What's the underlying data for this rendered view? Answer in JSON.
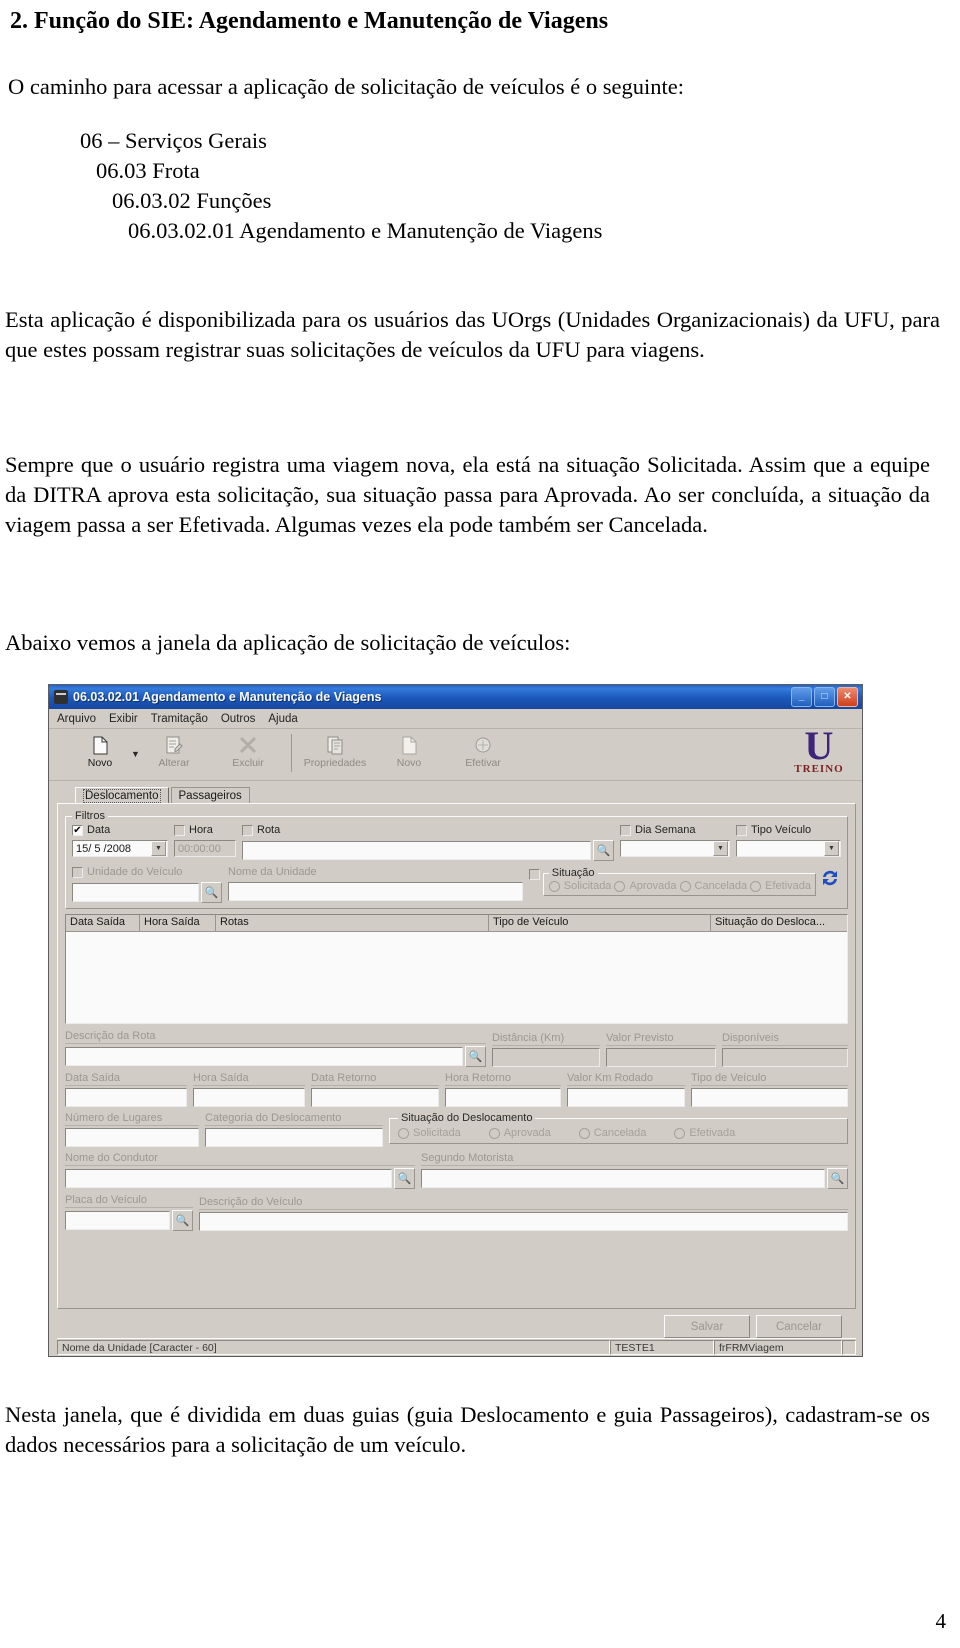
{
  "document": {
    "title": "2. Função do SIE: Agendamento e Manutenção de Viagens",
    "intro": "O caminho para acessar a aplicação de solicitação de veículos é o seguinte:",
    "path": [
      "06 – Serviços Gerais",
      "06.03 Frota",
      "06.03.02 Funções",
      "06.03.02.01 Agendamento e Manutenção de Viagens"
    ],
    "paragraph_1": "Esta aplicação é disponibilizada para os usuários das UOrgs (Unidades Organizacionais) da UFU, para que estes possam registrar suas solicitações de veículos da UFU para viagens.",
    "paragraph_2": "Sempre que o usuário registra uma viagem nova, ela está na situação Solicitada. Assim que a equipe da DITRA aprova esta solicitação, sua situação passa para Aprovada. Ao ser concluída, a situação da viagem passa a ser Efetivada. Algumas vezes ela pode também ser Cancelada.",
    "paragraph_3": "Abaixo vemos a janela da aplicação de solicitação de veículos:",
    "paragraph_4": "Nesta janela, que é dividida em duas guias (guia Deslocamento e guia Passageiros), cadastram-se os dados necessários para a solicitação de um veículo.",
    "page_number": "4"
  },
  "app": {
    "title": "06.03.02.01 Agendamento e Manutenção de Viagens",
    "window_buttons": {
      "minimize": "_",
      "maximize": "□",
      "close": "✕"
    },
    "menu": [
      "Arquivo",
      "Exibir",
      "Tramitação",
      "Outros",
      "Ajuda"
    ],
    "toolbar": [
      {
        "label": "Novo",
        "icon": "new-document-icon",
        "enabled": true
      },
      {
        "label": "Alterar",
        "icon": "edit-document-icon",
        "enabled": false
      },
      {
        "label": "Excluir",
        "icon": "delete-x-icon",
        "enabled": false
      },
      {
        "label": "Propriedades",
        "icon": "properties-icon",
        "enabled": false
      },
      {
        "label": "Novo",
        "icon": "new-page-icon",
        "enabled": false
      },
      {
        "label": "Efetivar",
        "icon": "effectivate-icon",
        "enabled": false
      }
    ],
    "logo": {
      "mark": "U",
      "text": "TREINO"
    },
    "tabs": [
      {
        "label": "Deslocamento",
        "active": true
      },
      {
        "label": "Passageiros",
        "active": false
      }
    ],
    "filters": {
      "legend": "Filtros",
      "data": {
        "label": "Data",
        "checked": true,
        "value": "15/ 5 /2008"
      },
      "hora": {
        "label": "Hora",
        "checked": false,
        "value": "00:00:00"
      },
      "rota": {
        "label": "Rota",
        "checked": false,
        "value": ""
      },
      "dia_semana": {
        "label": "Dia Semana",
        "checked": false,
        "value": ""
      },
      "tipo_veiculo": {
        "label": "Tipo Veículo",
        "checked": false,
        "value": ""
      },
      "unidade_veiculo": {
        "label": "Unidade do Veículo",
        "checked": false,
        "value": ""
      },
      "nome_unidade": {
        "label": "Nome da Unidade",
        "value": ""
      },
      "situacao": {
        "legend": "Situação",
        "checked": false,
        "options": [
          "Solicitada",
          "Aprovada",
          "Cancelada",
          "Efetivada"
        ]
      },
      "refresh_icon": "refresh-icon"
    },
    "grid": {
      "columns": [
        "Data Saída",
        "Hora Saída",
        "Rotas",
        "Tipo de Veículo",
        "Situação do Desloca..."
      ],
      "rows": []
    },
    "detail": {
      "descricao_rota": {
        "label": "Descrição da Rota",
        "value": ""
      },
      "distancia_km": {
        "label": "Distância (Km)",
        "value": ""
      },
      "valor_previsto": {
        "label": "Valor Previsto",
        "value": ""
      },
      "disponiveis": {
        "label": "Disponíveis",
        "value": ""
      },
      "data_saida": {
        "label": "Data Saída",
        "value": ""
      },
      "hora_saida": {
        "label": "Hora Saída",
        "value": ""
      },
      "data_retorno": {
        "label": "Data Retorno",
        "value": ""
      },
      "hora_retorno": {
        "label": "Hora Retorno",
        "value": ""
      },
      "valor_km_rodado": {
        "label": "Valor Km Rodado",
        "value": ""
      },
      "tipo_veiculo": {
        "label": "Tipo de Veículo",
        "value": ""
      },
      "numero_lugares": {
        "label": "Número de Lugares",
        "value": ""
      },
      "categoria_deslocamento": {
        "label": "Categoria do Deslocamento",
        "value": ""
      },
      "situacao_deslocamento": {
        "legend": "Situação do Deslocamento",
        "options": [
          "Solicitada",
          "Aprovada",
          "Cancelada",
          "Efetivada"
        ]
      },
      "nome_condutor": {
        "label": "Nome do Condutor",
        "value": ""
      },
      "segundo_motorista": {
        "label": "Segundo Motorista",
        "value": ""
      },
      "placa_veiculo": {
        "label": "Placa do Veículo",
        "value": ""
      },
      "descricao_veiculo": {
        "label": "Descrição do Veículo",
        "value": ""
      }
    },
    "buttons": {
      "salvar": "Salvar",
      "cancelar": "Cancelar"
    },
    "statusbar": {
      "hint": "Nome da Unidade [Caracter - 60]",
      "user": "TESTE1",
      "form": "frFRMViagem"
    }
  }
}
